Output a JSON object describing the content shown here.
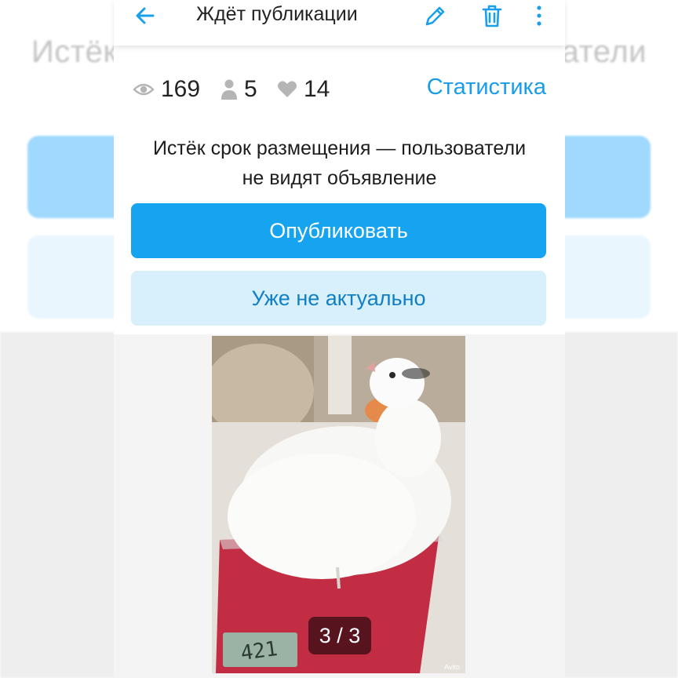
{
  "background": {
    "title_left_fragment": "Истёк",
    "title_right_fragment": "атели"
  },
  "appbar": {
    "title": "Ждёт публикации",
    "icons": [
      "arrow-left-icon",
      "pencil-icon",
      "trash-icon",
      "more-vertical-icon"
    ]
  },
  "stats": {
    "views": "169",
    "contacts": "5",
    "favorites": "14",
    "link_label": "Статистика"
  },
  "notice": {
    "line1": "Истёк срок размещения — пользователи",
    "line2": "не видят объявление"
  },
  "actions": {
    "publish_label": "Опубликовать",
    "not_relevant_label": "Уже не актуально"
  },
  "gallery": {
    "counter": "3 / 3",
    "watermark": "Avito",
    "scale_reading": "421"
  },
  "colors": {
    "accent": "#16a4f0",
    "link": "#1a9de8",
    "secondary_button_bg": "#d8effc",
    "secondary_button_text": "#0f7fc6"
  }
}
